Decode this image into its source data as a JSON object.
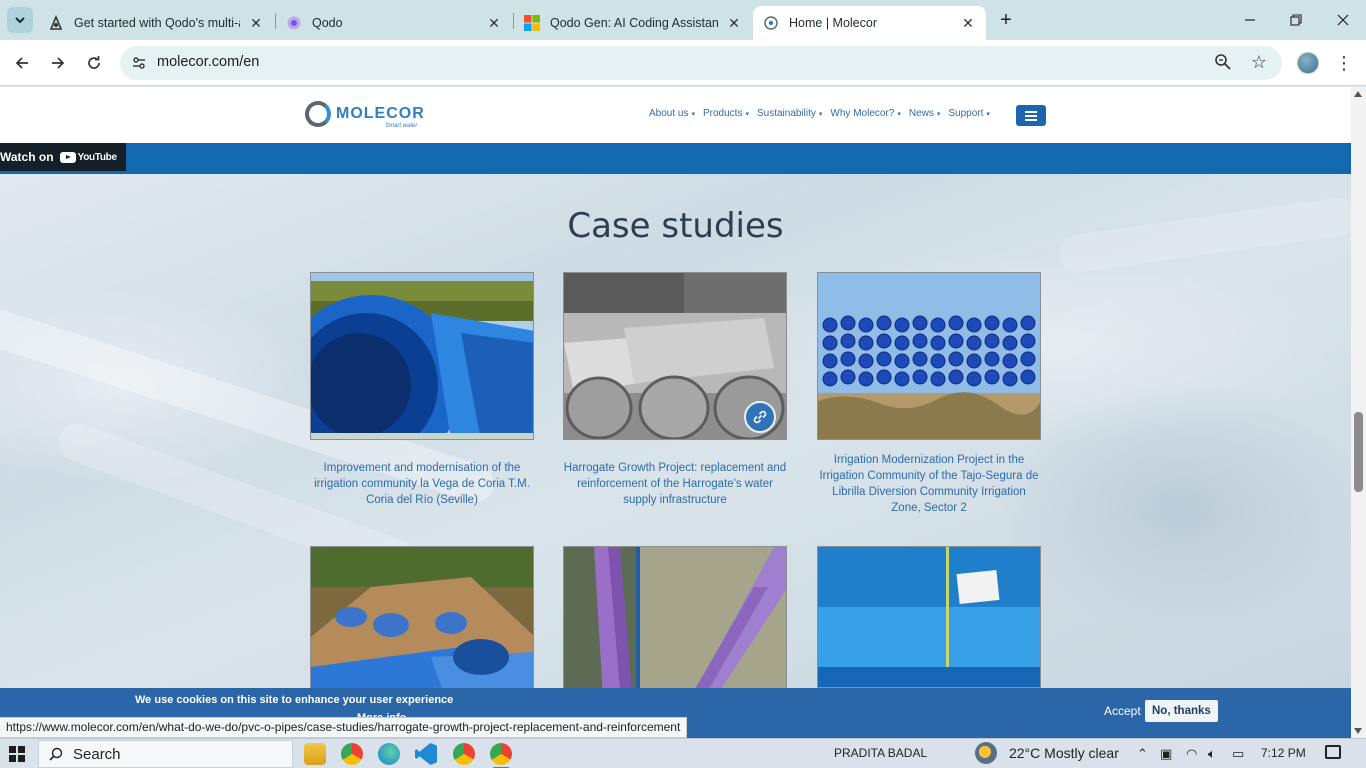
{
  "browser": {
    "tabs": [
      {
        "title": "Get started with Qodo's multi-a",
        "icon": "qodo-docs-icon",
        "active": false
      },
      {
        "title": "Qodo",
        "icon": "qodo-icon",
        "active": false
      },
      {
        "title": "Qodo Gen: AI Coding Assistant",
        "icon": "microsoft-store-icon",
        "active": false
      },
      {
        "title": "Home | Molecor",
        "icon": "globe-icon",
        "active": true
      }
    ],
    "url": "molecor.com/en",
    "status_url": "https://www.molecor.com/en/what-do-we-do/pvc-o-pipes/case-studies/harrogate-growth-project-replacement-and-reinforcement"
  },
  "site": {
    "logo_text": "MOLECOR",
    "logo_tagline": "Smart water",
    "nav": [
      {
        "label": "About us"
      },
      {
        "label": "Products"
      },
      {
        "label": "Sustainability"
      },
      {
        "label": "Why Molecor?"
      },
      {
        "label": "News"
      },
      {
        "label": "Support"
      }
    ],
    "video": {
      "watch_on": "Watch on",
      "platform": "YouTube"
    },
    "section_title": "Case studies",
    "cards": [
      {
        "caption": "Improvement and modernisation of the irrigation community la Vega de Coria T.M. Coria del Río (Seville)"
      },
      {
        "caption": "Harrogate Growth Project: replacement and reinforcement of the Harrogate's water supply infrastructure"
      },
      {
        "caption": "Irrigation Modernization Project in the Irrigation Community of the Tajo-Segura de Librilla Diversion Community Irrigation Zone, Sector 2"
      },
      {
        "caption": ""
      },
      {
        "caption": ""
      },
      {
        "caption": ""
      }
    ],
    "cookie": {
      "message": "We use cookies on this site to enhance your user experience",
      "more_info": "More info",
      "accept": "Accept",
      "decline": "No, thanks"
    }
  },
  "taskbar": {
    "search_placeholder": "Search",
    "user": "PRADITA BADAL",
    "weather": "22°C  Mostly clear",
    "time": "7:12 PM"
  },
  "colors": {
    "brand_blue": "#2f7fc2",
    "strip_blue": "#1269ad",
    "cookie_bar": "#2a66a8",
    "tab_bar": "#cfe3e7"
  }
}
